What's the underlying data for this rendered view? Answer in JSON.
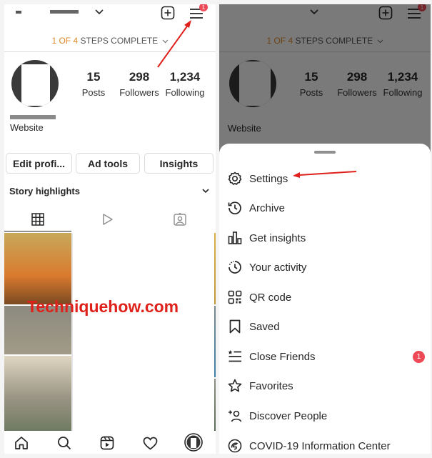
{
  "profile": {
    "steps_count": "1 OF 4",
    "steps_text": "STEPS COMPLETE",
    "stats": [
      {
        "value": "15",
        "label": "Posts"
      },
      {
        "value": "298",
        "label": "Followers"
      },
      {
        "value": "1,234",
        "label": "Following"
      }
    ],
    "website_label": "Website",
    "buttons": {
      "edit": "Edit profi...",
      "ad_tools": "Ad tools",
      "insights": "Insights"
    },
    "story_highlights": "Story highlights",
    "notification_count": "1"
  },
  "watermark": "Techniquehow.com",
  "menu": {
    "items": [
      {
        "label": "Settings",
        "icon": "settings-gear-icon"
      },
      {
        "label": "Archive",
        "icon": "archive-clock-icon"
      },
      {
        "label": "Get insights",
        "icon": "insights-bar-chart-icon"
      },
      {
        "label": "Your activity",
        "icon": "activity-clock-icon"
      },
      {
        "label": "QR code",
        "icon": "qr-code-icon"
      },
      {
        "label": "Saved",
        "icon": "bookmark-icon"
      },
      {
        "label": "Close Friends",
        "icon": "close-friends-list-icon",
        "badge": "1"
      },
      {
        "label": "Favorites",
        "icon": "star-icon"
      },
      {
        "label": "Discover People",
        "icon": "add-person-icon"
      },
      {
        "label": "COVID-19 Information Center",
        "icon": "covid-info-icon"
      }
    ]
  },
  "colors": {
    "accent_orange": "#e08a2b",
    "arrow_red": "#e0201a",
    "badge_red": "#ed4956"
  }
}
